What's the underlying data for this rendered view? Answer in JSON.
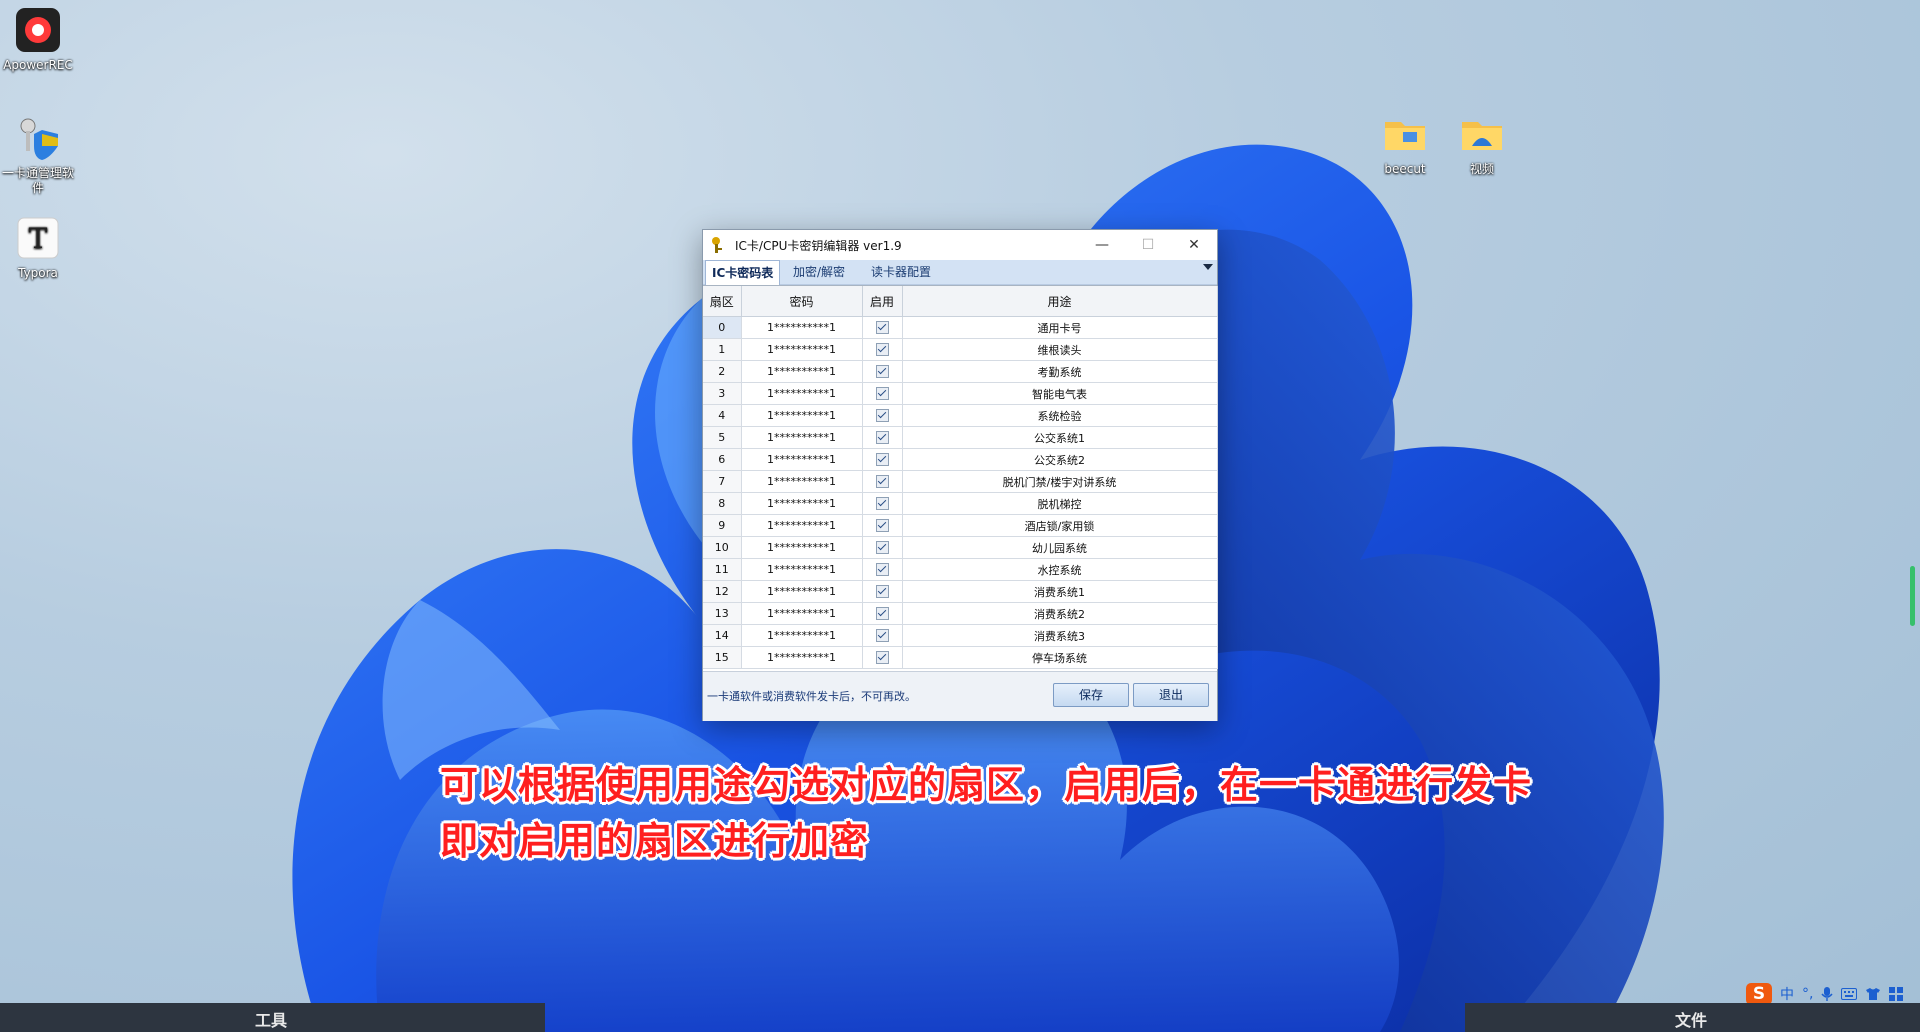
{
  "desktop": {
    "icons": [
      {
        "label": "ApowerREC",
        "icon": "record-icon"
      },
      {
        "label": "一卡通管理软件",
        "icon": "key-shield-icon"
      },
      {
        "label": "Typora",
        "icon": "typora-icon"
      },
      {
        "label": "beecut",
        "icon": "folder-icon"
      },
      {
        "label": "视频",
        "icon": "folder-icon"
      }
    ]
  },
  "window": {
    "title": "IC卡/CPU卡密钥编辑器 ver1.9",
    "controls": {
      "minimize": "—",
      "maximize": "☐",
      "close": "✕"
    },
    "tabs": [
      {
        "label": "IC卡密码表",
        "active": true
      },
      {
        "label": "加密/解密",
        "active": false
      },
      {
        "label": "读卡器配置",
        "active": false
      }
    ],
    "table": {
      "headers": [
        "扇区",
        "密码",
        "启用",
        "用途"
      ],
      "rows": [
        {
          "sector": "0",
          "password": "1**********1",
          "enabled": true,
          "purpose": "通用卡号"
        },
        {
          "sector": "1",
          "password": "1**********1",
          "enabled": true,
          "purpose": "维根读头"
        },
        {
          "sector": "2",
          "password": "1**********1",
          "enabled": true,
          "purpose": "考勤系统"
        },
        {
          "sector": "3",
          "password": "1**********1",
          "enabled": true,
          "purpose": "智能电气表"
        },
        {
          "sector": "4",
          "password": "1**********1",
          "enabled": true,
          "purpose": "系统检验"
        },
        {
          "sector": "5",
          "password": "1**********1",
          "enabled": true,
          "purpose": "公交系统1"
        },
        {
          "sector": "6",
          "password": "1**********1",
          "enabled": true,
          "purpose": "公交系统2"
        },
        {
          "sector": "7",
          "password": "1**********1",
          "enabled": true,
          "purpose": "脱机门禁/楼宇对讲系统"
        },
        {
          "sector": "8",
          "password": "1**********1",
          "enabled": true,
          "purpose": "脱机梯控"
        },
        {
          "sector": "9",
          "password": "1**********1",
          "enabled": true,
          "purpose": "酒店锁/家用锁"
        },
        {
          "sector": "10",
          "password": "1**********1",
          "enabled": true,
          "purpose": "幼儿园系统"
        },
        {
          "sector": "11",
          "password": "1**********1",
          "enabled": true,
          "purpose": "水控系统"
        },
        {
          "sector": "12",
          "password": "1**********1",
          "enabled": true,
          "purpose": "消费系统1"
        },
        {
          "sector": "13",
          "password": "1**********1",
          "enabled": true,
          "purpose": "消费系统2"
        },
        {
          "sector": "14",
          "password": "1**********1",
          "enabled": true,
          "purpose": "消费系统3"
        },
        {
          "sector": "15",
          "password": "1**********1",
          "enabled": true,
          "purpose": "停车场系统"
        }
      ]
    },
    "status_text": "一卡通软件或消费软件发卡后，不可再改。",
    "buttons": {
      "save": "保存",
      "exit": "退出"
    }
  },
  "caption": {
    "line1": "可以根据使用用途勾选对应的扇区，启用后，在一卡通进行发卡",
    "line2": "即对启用的扇区进行加密"
  },
  "bottom_bar": {
    "left_label": "工具",
    "right_label": "文件"
  },
  "ime": {
    "logo": "S",
    "lang": "中",
    "punct": "°,"
  },
  "colors": {
    "caption": "#ff1f1f",
    "tab_bar": "#d3e2f4",
    "accent": "#1b3c72"
  }
}
